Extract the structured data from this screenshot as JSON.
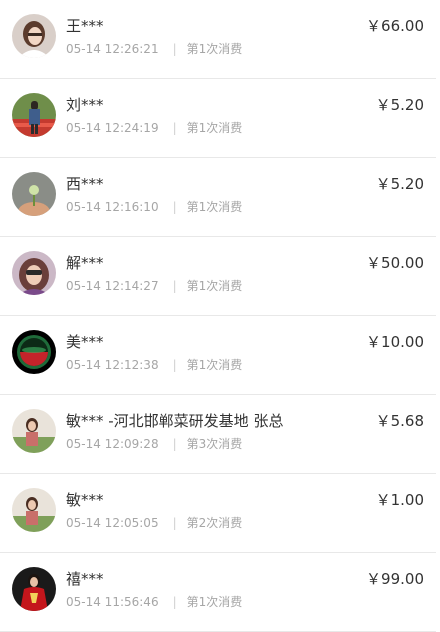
{
  "records": [
    {
      "name": "王***",
      "time": "05-14 12:26:21",
      "visit": "第1次消费",
      "amount": "￥66.00",
      "avatar": "avatar-woman-glasses-photo"
    },
    {
      "name": "刘***",
      "time": "05-14 12:24:19",
      "visit": "第1次消费",
      "amount": "￥5.20",
      "avatar": "avatar-person-flower-field-photo"
    },
    {
      "name": "西***",
      "time": "05-14 12:16:10",
      "visit": "第1次消费",
      "amount": "￥5.20",
      "avatar": "avatar-flower-bud-photo"
    },
    {
      "name": "解***",
      "time": "05-14 12:14:27",
      "visit": "第1次消费",
      "amount": "￥50.00",
      "avatar": "avatar-woman-sunglasses-photo"
    },
    {
      "name": "美***",
      "time": "05-14 12:12:38",
      "visit": "第1次消费",
      "amount": "￥10.00",
      "avatar": "avatar-red-green-orb"
    },
    {
      "name": "敏*** -河北邯郸菜研发基地 张总",
      "time": "05-14 12:09:28",
      "visit": "第3次消费",
      "amount": "￥5.68",
      "avatar": "avatar-woman-greenhouse-photo"
    },
    {
      "name": "敏***",
      "time": "05-14 12:05:05",
      "visit": "第2次消费",
      "amount": "￥1.00",
      "avatar": "avatar-woman-greenhouse-photo"
    },
    {
      "name": "禧***",
      "time": "05-14 11:56:46",
      "visit": "第1次消费",
      "amount": "￥99.00",
      "avatar": "avatar-person-red-outfit-photo"
    }
  ]
}
